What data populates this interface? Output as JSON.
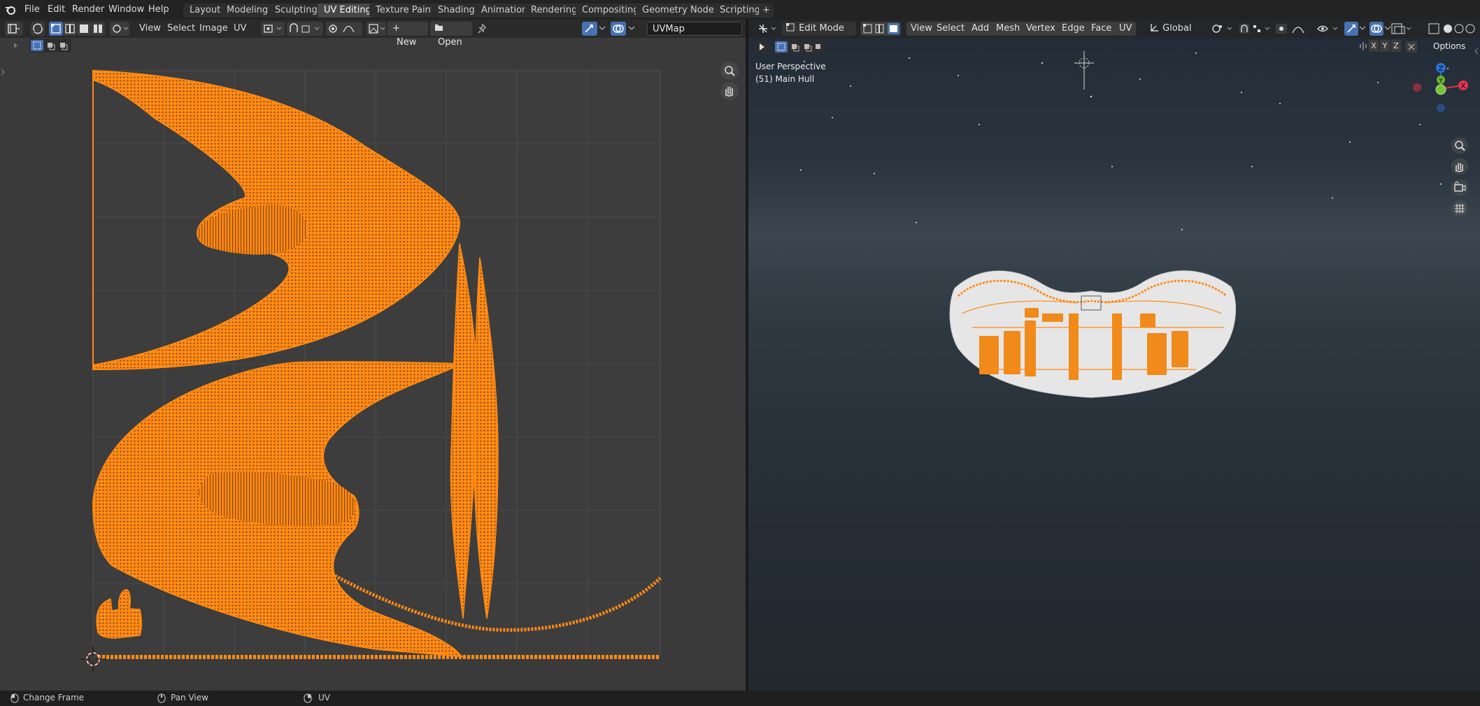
{
  "topbar": {
    "menus": [
      "File",
      "Edit",
      "Render",
      "Window",
      "Help"
    ],
    "workspaces": [
      "Layout",
      "Modeling",
      "Sculpting",
      "UV Editing",
      "Texture Paint",
      "Shading",
      "Animation",
      "Rendering",
      "Compositing",
      "Geometry Nodes",
      "Scripting"
    ],
    "active_workspace": "UV Editing",
    "add_tab": "+"
  },
  "uv_editor": {
    "menus": [
      "View",
      "Select",
      "Image",
      "UV"
    ],
    "new_label": "New",
    "open_label": "Open",
    "new_prefix": "+",
    "uvmap_name": "UVMap",
    "uv_color": "#ff8a14"
  },
  "viewport": {
    "mode": "Edit Mode",
    "menus": [
      "View",
      "Select",
      "Add",
      "Mesh",
      "Vertex",
      "Edge",
      "Face",
      "UV"
    ],
    "orientation": "Global",
    "options_label": "Options",
    "axis_x": "X",
    "axis_y": "Y",
    "axis_z": "Z",
    "perspective": "User Perspective",
    "object": "(51) Main Hull"
  },
  "status": {
    "left": "Change Frame",
    "middle": "Pan View",
    "right": "UV"
  },
  "icons": [
    "blender-logo-icon",
    "editor-type-icon",
    "sync-selection-icon",
    "vertex-select-icon",
    "edge-select-icon",
    "face-select-icon",
    "island-select-icon",
    "pivot-icon",
    "snap-icon",
    "proportional-icon",
    "image-icon",
    "pin-icon",
    "gizmo-icon",
    "overlay-icon",
    "zoom-icon",
    "hand-icon",
    "camera-icon",
    "grid-icon",
    "play-icon"
  ]
}
